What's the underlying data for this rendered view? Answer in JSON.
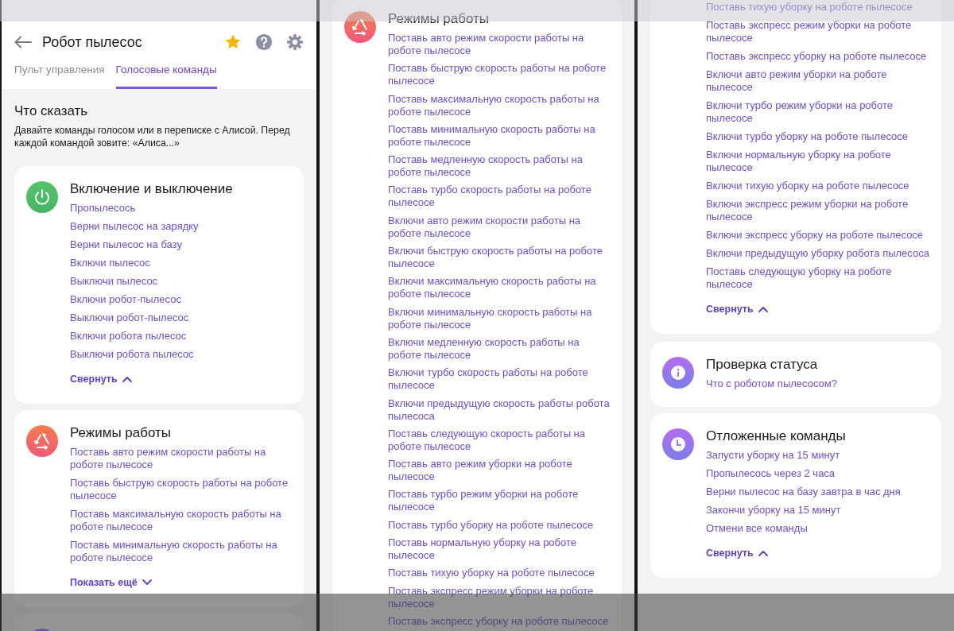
{
  "panels": [
    {
      "header": {
        "title": "Робот пылесос",
        "tabs": [
          {
            "label": "Пульт управления",
            "selected": false
          },
          {
            "label": "Голосовые команды",
            "selected": true
          }
        ]
      },
      "intro": {
        "title": "Что сказать",
        "text": "Давайте команды голосом или в переписке с Алисой. Перед каждой командой зовите: «Алиса...»"
      },
      "cards": [
        {
          "kind": "power",
          "title": "Включение и выключение",
          "commands": [
            "Пропылесось",
            "Верни пылесос на зарядку",
            "Верни пылесос на базу",
            "Включи пылесос",
            "Выключи пылесос",
            "Включи робот-пылесос",
            "Выключи робот-пылесос",
            "Включи робота пылесос",
            "Выключи робота пылесос"
          ],
          "toggle": {
            "label": "Свернуть",
            "expanded": true
          }
        },
        {
          "kind": "modes",
          "title": "Режимы работы",
          "commands": [
            "Поставь авто режим скорости работы на роботе пылесосе",
            "Поставь быструю скорость работы на роботе пылесосе",
            "Поставь максимальную скорость работы на роботе пылесосе",
            "Поставь минимальную скорость работы на роботе пылесосе"
          ],
          "toggle": {
            "label": "Показать ещё",
            "expanded": false
          }
        },
        {
          "kind": "blank"
        }
      ]
    },
    {
      "cards": [
        {
          "kind": "modes",
          "title": "Режимы работы",
          "commands": [
            "Поставь авто режим скорости работы на роботе пылесосе",
            "Поставь быструю скорость работы на роботе пылесосе",
            "Поставь максимальную скорость работы на роботе пылесосе",
            "Поставь минимальную скорость работы на роботе пылесосе",
            "Поставь медленную скорость работы на роботе пылесосе",
            "Поставь турбо скорость работы на роботе пылесосе",
            "Включи авто режим скорости работы на роботе пылесосе",
            "Включи быструю скорость работы на роботе пылесосе",
            "Включи максимальную скорость работы на роботе пылесосе",
            "Включи минимальную скорость работы на роботе пылесосе",
            "Включи медленную скорость работы на роботе пылесосе",
            "Включи турбо скорость работы на роботе пылесосе",
            "Включи предыдущую скорость работы робота пылесоса",
            "Поставь следующую скорость работы на роботе пылесосе",
            "Поставь авто режим уборки на роботе пылесосе",
            "Поставь турбо режим уборки на роботе пылесосе",
            "Поставь турбо уборку на роботе пылесосе",
            "Поставь нормальную уборку на роботе пылесосе",
            "Поставь тихую уборку на роботе пылесосе",
            "Поставь экспресс режим уборки на роботе пылесосе",
            "Поставь экспресс уборку на роботе пылесосе"
          ]
        }
      ]
    },
    {
      "cards": [
        {
          "kind": "continued",
          "commands": [
            "Поставь тихую уборку на роботе пылесосе",
            "Поставь экспресс режим уборки на роботе пылесосе",
            "Поставь экспресс уборку на роботе пылесосе",
            "Включи авто режим уборки на роботе пылесосе",
            "Включи турбо режим уборки на роботе пылесосе",
            "Включи турбо уборку на роботе пылесосе",
            "Включи нормальную уборку на роботе пылесосе",
            "Включи тихую уборку на роботе пылесосе",
            "Включи экспресс режим уборки на роботе пылесосе",
            "Включи экспресс уборку на роботе пылесосе",
            "Включи предыдущую уборку робота пылесоса",
            "Поставь следующую уборку на роботе пылесосе"
          ],
          "toggle": {
            "label": "Свернуть",
            "expanded": true
          }
        },
        {
          "kind": "info",
          "title": "Проверка статуса",
          "commands": [
            "Что с роботом пылесосом?"
          ]
        },
        {
          "kind": "clock",
          "title": "Отложенные команды",
          "commands": [
            "Запусти уборку на 15 минут",
            "Пропылесось через 2 часа",
            "Верни пылесос на базу завтра в час дня",
            "Закончи уборку на 15 минут",
            "Отмени все команды"
          ],
          "toggle": {
            "label": "Свернуть",
            "expanded": true
          }
        }
      ]
    }
  ]
}
